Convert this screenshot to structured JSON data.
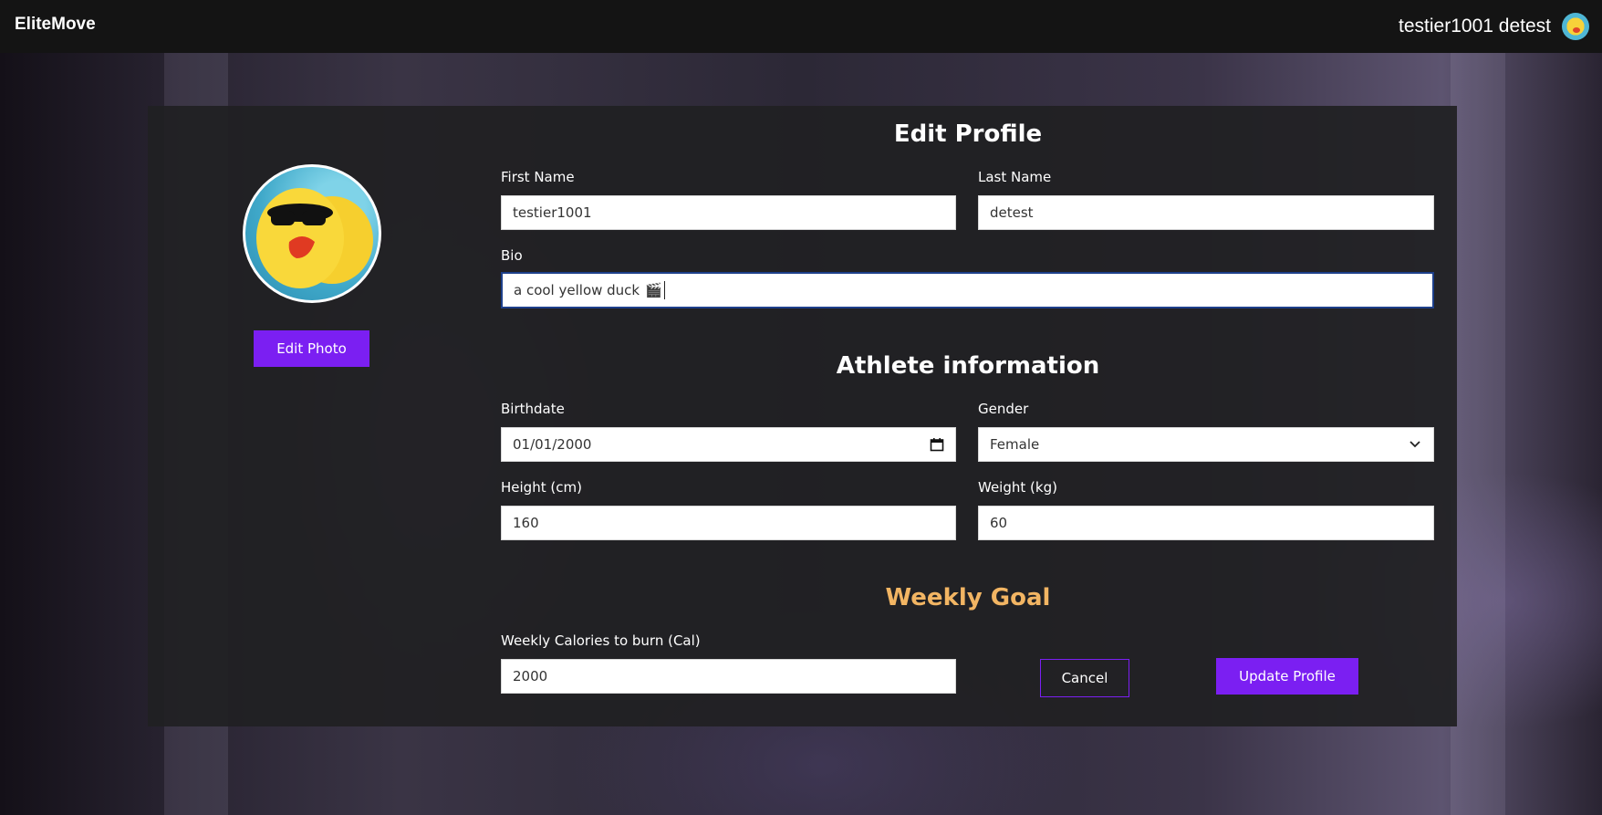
{
  "header": {
    "brand": "EliteMove",
    "user_name": "testier1001 detest"
  },
  "profile": {
    "edit_photo_label": "Edit Photo",
    "title": "Edit Profile",
    "first_name_label": "First Name",
    "first_name_value": "testier1001",
    "last_name_label": "Last Name",
    "last_name_value": "detest",
    "bio_label": "Bio",
    "bio_value": "a cool yellow duck"
  },
  "athlete": {
    "title": "Athlete information",
    "birthdate_label": "Birthdate",
    "birthdate_value": "01/01/2000",
    "gender_label": "Gender",
    "gender_value": "Female",
    "height_label": "Height (cm)",
    "height_value": "160",
    "weight_label": "Weight (kg)",
    "weight_value": "60"
  },
  "goal": {
    "title": "Weekly Goal",
    "calories_label": "Weekly Calories to burn (Cal)",
    "calories_value": "2000"
  },
  "actions": {
    "cancel_label": "Cancel",
    "update_label": "Update Profile"
  },
  "colors": {
    "accent": "#7b1ff2",
    "goal_title": "#f2b563",
    "topbar": "#141414"
  }
}
